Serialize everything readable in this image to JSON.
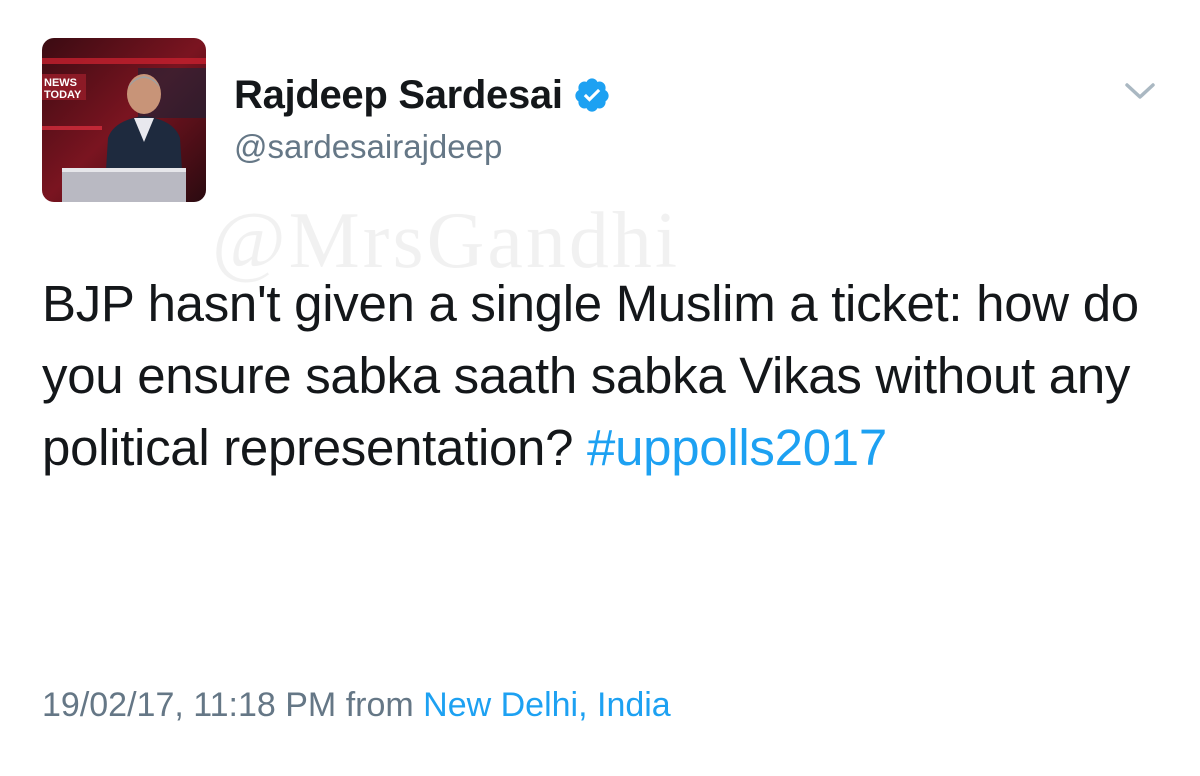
{
  "author": {
    "display_name": "Rajdeep Sardesai",
    "handle": "@sardesairajdeep",
    "verified": true,
    "avatar_badge_text": "NEWS TODAY"
  },
  "watermark": "@MrsGandhi",
  "tweet": {
    "text": "BJP hasn't given a single Muslim a ticket: how do you ensure sabka saath sabka Vikas without any political representation?",
    "hashtag": "#uppolls2017"
  },
  "meta": {
    "timestamp": "19/02/17, 11:18 PM",
    "from_label": "from",
    "location": "New Delhi, India"
  },
  "icons": {
    "verified": "verified-badge-icon",
    "menu": "chevron-down-icon"
  },
  "colors": {
    "link": "#1da1f2",
    "text": "#14171a",
    "secondary": "#657786"
  }
}
